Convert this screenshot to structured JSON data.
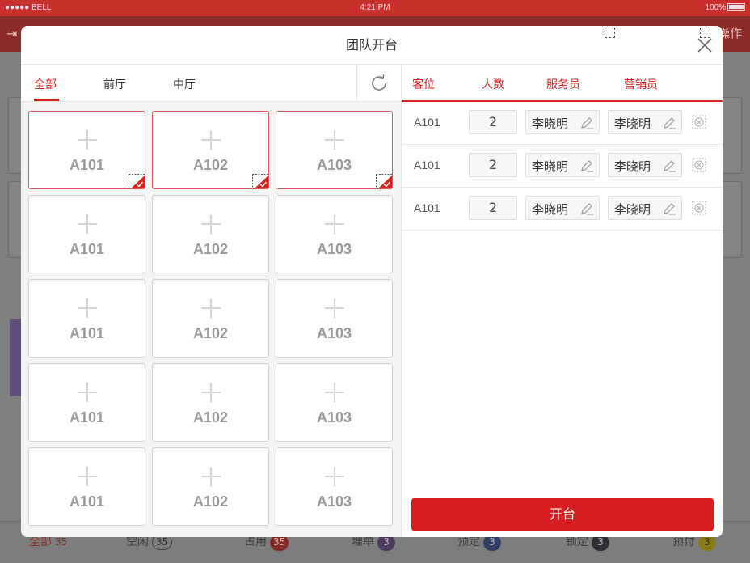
{
  "status_bar": {
    "carrier": "●●●●● BELL",
    "time": "4:21 PM",
    "battery": "100%"
  },
  "background": {
    "header_action": "操作",
    "footer": [
      {
        "label": "全部",
        "count": "35"
      },
      {
        "label": "空闲",
        "count": "35"
      },
      {
        "label": "占用",
        "count": "35"
      },
      {
        "label": "埋单",
        "count": "3"
      },
      {
        "label": "预定",
        "count": "3"
      },
      {
        "label": "锁定",
        "count": "3"
      },
      {
        "label": "预付",
        "count": "3"
      }
    ]
  },
  "modal": {
    "title": "团队开台",
    "tabs": [
      "全部",
      "前厅",
      "中厅"
    ],
    "active_tab": 0,
    "tables": [
      {
        "name": "A101",
        "selected": true
      },
      {
        "name": "A102",
        "selected": true
      },
      {
        "name": "A103",
        "selected": true
      },
      {
        "name": "A101",
        "selected": false
      },
      {
        "name": "A102",
        "selected": false
      },
      {
        "name": "A103",
        "selected": false
      },
      {
        "name": "A101",
        "selected": false
      },
      {
        "name": "A102",
        "selected": false
      },
      {
        "name": "A103",
        "selected": false
      },
      {
        "name": "A101",
        "selected": false
      },
      {
        "name": "A102",
        "selected": false
      },
      {
        "name": "A103",
        "selected": false
      },
      {
        "name": "A101",
        "selected": false
      },
      {
        "name": "A102",
        "selected": false
      },
      {
        "name": "A103",
        "selected": false
      }
    ],
    "columns": [
      "客位",
      "人数",
      "服务员",
      "营销员"
    ],
    "rows": [
      {
        "seat": "A101",
        "guests": "2",
        "waiter": "李晓明",
        "marketer": "李晓明"
      },
      {
        "seat": "A101",
        "guests": "2",
        "waiter": "李晓明",
        "marketer": "李晓明"
      },
      {
        "seat": "A101",
        "guests": "2",
        "waiter": "李晓明",
        "marketer": "李晓明"
      }
    ],
    "submit_label": "开台",
    "accent_color": "#d9201f"
  }
}
